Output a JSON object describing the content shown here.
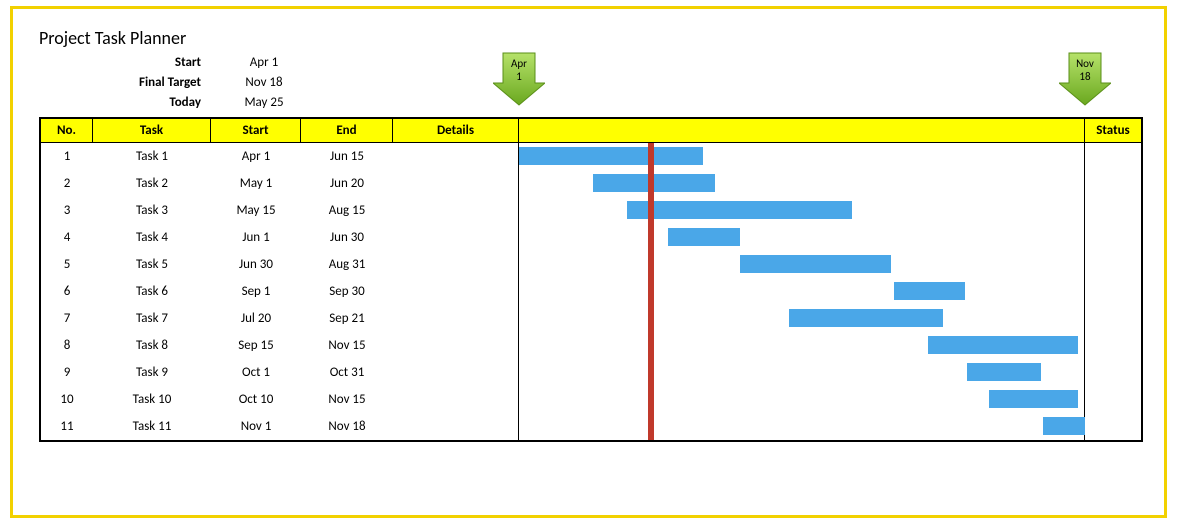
{
  "title": "Project Task Planner",
  "meta": {
    "start_label": "Start",
    "start_value": "Apr 1",
    "final_label": "Final Target",
    "final_value": "Nov 18",
    "today_label": "Today",
    "today_value": "May 25"
  },
  "markers": {
    "start": "Apr 1",
    "end": "Nov 18"
  },
  "columns": {
    "no": "No.",
    "task": "Task",
    "start": "Start",
    "end": "End",
    "details": "Details",
    "status": "Status"
  },
  "tasks": [
    {
      "no": "1",
      "name": "Task 1",
      "start": "Apr 1",
      "end": "Jun 15"
    },
    {
      "no": "2",
      "name": "Task 2",
      "start": "May 1",
      "end": "Jun 20"
    },
    {
      "no": "3",
      "name": "Task 3",
      "start": "May 15",
      "end": "Aug 15"
    },
    {
      "no": "4",
      "name": "Task 4",
      "start": "Jun 1",
      "end": "Jun 30"
    },
    {
      "no": "5",
      "name": "Task 5",
      "start": "Jun 30",
      "end": "Aug 31"
    },
    {
      "no": "6",
      "name": "Task 6",
      "start": "Sep 1",
      "end": "Sep 30"
    },
    {
      "no": "7",
      "name": "Task 7",
      "start": "Jul 20",
      "end": "Sep 21"
    },
    {
      "no": "8",
      "name": "Task 8",
      "start": "Sep 15",
      "end": "Nov 15"
    },
    {
      "no": "9",
      "name": "Task 9",
      "start": "Oct 1",
      "end": "Oct 31"
    },
    {
      "no": "10",
      "name": "Task 10",
      "start": "Oct 10",
      "end": "Nov 15"
    },
    {
      "no": "11",
      "name": "Task 11",
      "start": "Nov 1",
      "end": "Nov 18"
    }
  ],
  "chart_data": {
    "type": "bar",
    "title": "Project Task Planner",
    "x_range": [
      "Apr 1",
      "Nov 18"
    ],
    "today": "May 25",
    "series": [
      {
        "name": "Task 1",
        "start": "Apr 1",
        "end": "Jun 15"
      },
      {
        "name": "Task 2",
        "start": "May 1",
        "end": "Jun 20"
      },
      {
        "name": "Task 3",
        "start": "May 15",
        "end": "Aug 15"
      },
      {
        "name": "Task 4",
        "start": "Jun 1",
        "end": "Jun 30"
      },
      {
        "name": "Task 5",
        "start": "Jun 30",
        "end": "Aug 31"
      },
      {
        "name": "Task 6",
        "start": "Sep 1",
        "end": "Sep 30"
      },
      {
        "name": "Task 7",
        "start": "Jul 20",
        "end": "Sep 21"
      },
      {
        "name": "Task 8",
        "start": "Sep 15",
        "end": "Nov 15"
      },
      {
        "name": "Task 9",
        "start": "Oct 1",
        "end": "Oct 31"
      },
      {
        "name": "Task 10",
        "start": "Oct 10",
        "end": "Nov 15"
      },
      {
        "name": "Task 11",
        "start": "Nov 1",
        "end": "Nov 18"
      }
    ]
  }
}
